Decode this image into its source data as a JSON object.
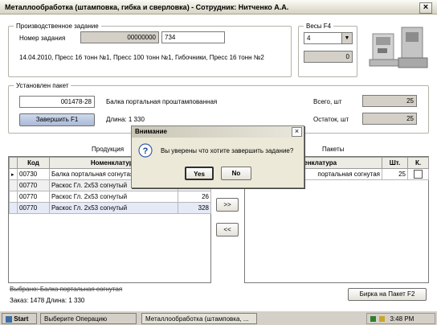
{
  "window": {
    "title": "Металлообработка (штамповка, гибка и сверловка) - Сотрудник: Нитченко А.А.",
    "close": "×"
  },
  "task": {
    "group_label": "Производственное задание",
    "number_label": "Номер задания",
    "number_value": "00000000",
    "number_suffix": "734",
    "description": "14.04.2010, Пресс 16 тонн №1, Пресс 100 тонн №1, Гибочники, Пресс 16 тонн №2"
  },
  "scales": {
    "group_label": "Весы  F4",
    "selected": "4",
    "reading": "0"
  },
  "package": {
    "group_label": "Установлен пакет",
    "code": "001478-28",
    "name": "Балка портальная проштампованная",
    "length_label": "Длина: 1 330",
    "finish_button": "Завершить      F1",
    "total_label": "Всего, шт",
    "total_value": "25",
    "remain_label": "Остаток, шт",
    "remain_value": "25"
  },
  "products": {
    "section_label": "Продукция",
    "columns": [
      "Код",
      "Номенклатура"
    ],
    "rows": [
      {
        "marker": "▸",
        "code": "00730",
        "name": "Балка портальная согнутая",
        "qty": ""
      },
      {
        "marker": "",
        "code": "00770",
        "name": "Раскос Гл. 2х53 согнутый",
        "qty": ""
      },
      {
        "marker": "",
        "code": "00770",
        "name": "Раскос Гл. 2х53 согнутый",
        "qty": "26"
      },
      {
        "marker": "",
        "code": "00770",
        "name": "Раскос Гл. 2х53 согнутый",
        "qty": "328"
      }
    ]
  },
  "packets": {
    "section_label": "Пакеты",
    "columns": [
      "Номенклатура",
      "Шт.",
      "К."
    ],
    "rows": [
      {
        "name": "портальная согнутая",
        "qty": "25",
        "checked": false
      }
    ]
  },
  "transfer": {
    "forward": ">>",
    "back": "<<"
  },
  "footer": {
    "selected": "Выбрано: Балка портальная согнутая",
    "order": "Заказ: 1478  Длина: 1 330",
    "tag_button": "Бирка на Пакет   F2"
  },
  "dialog": {
    "title": "Внимание",
    "icon": "question-icon",
    "message": "Вы уверены что хотите завершить задание?",
    "yes": "Yes",
    "no": "No",
    "close": "×"
  },
  "taskbar": {
    "start": "Start",
    "items": [
      "Выберите Операцию",
      "Металлообработка (штамповка, ..."
    ],
    "time": "3:48 PM"
  }
}
